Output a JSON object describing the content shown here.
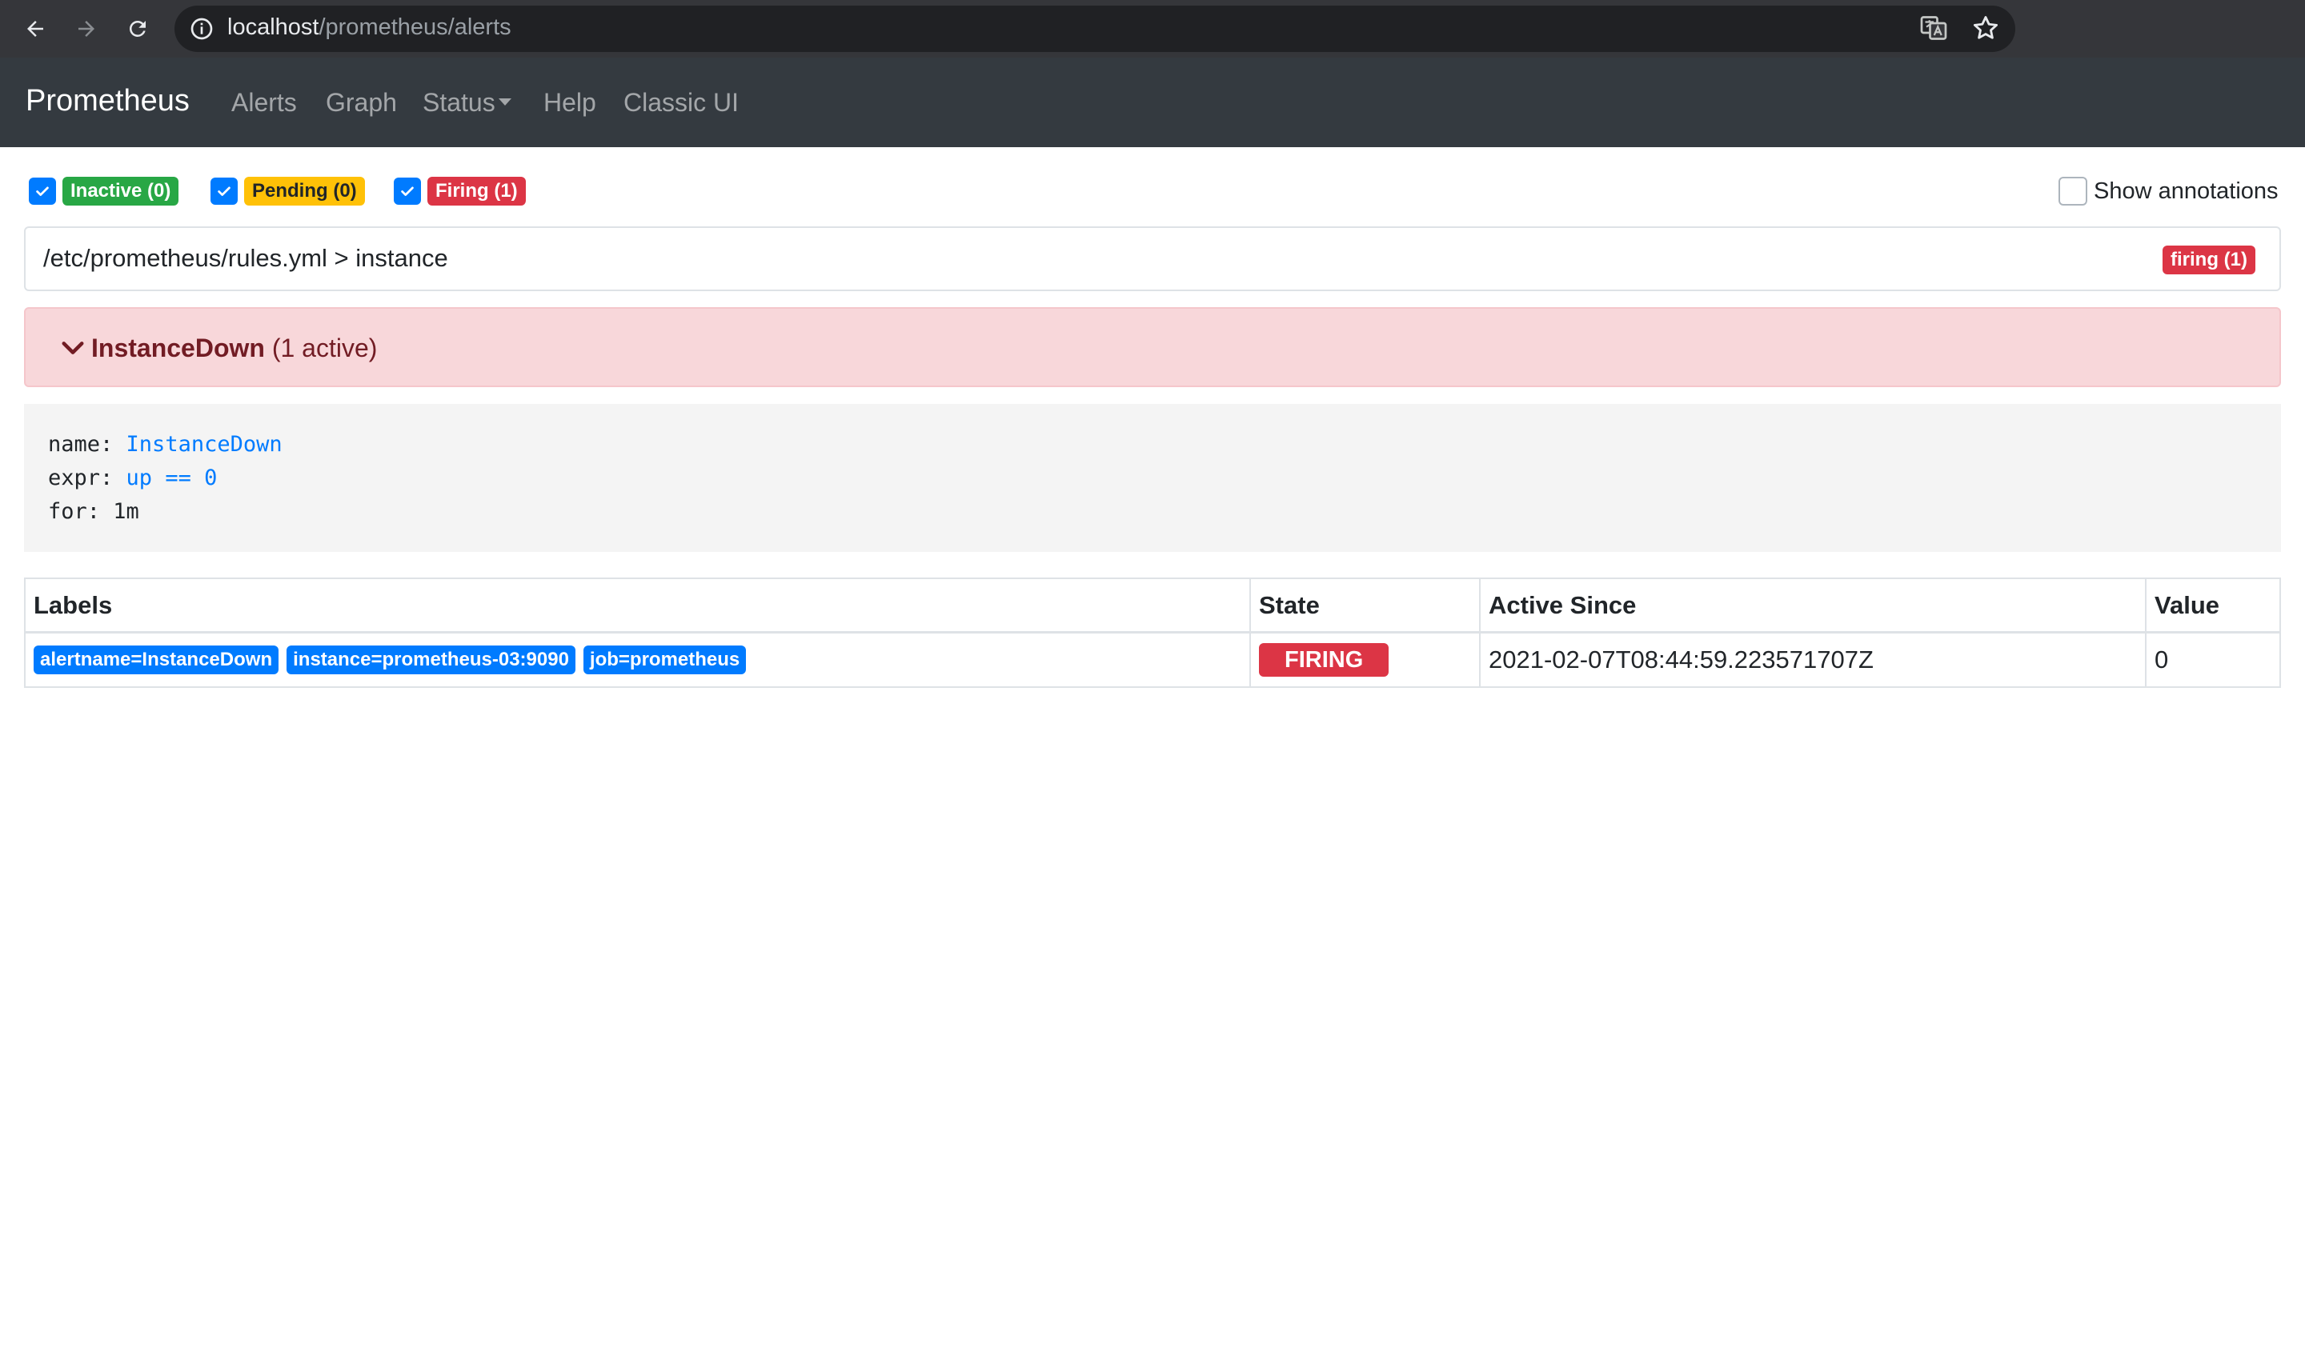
{
  "browser": {
    "url_host": "localhost",
    "url_path": "/prometheus/alerts"
  },
  "navbar": {
    "brand": "Prometheus",
    "links": [
      "Alerts",
      "Graph",
      "Status",
      "Help",
      "Classic UI"
    ]
  },
  "filters": {
    "inactive": "Inactive (0)",
    "pending": "Pending (0)",
    "firing": "Firing (1)",
    "show_annotations": "Show annotations"
  },
  "group": {
    "title": "/etc/prometheus/rules.yml > instance",
    "badge": "firing (1)"
  },
  "alert": {
    "name": "InstanceDown",
    "active": "(1 active)"
  },
  "rule": {
    "name_key": "name: ",
    "name_val": "InstanceDown",
    "expr_key": "expr: ",
    "expr_val": "up == 0",
    "for_key": "for: ",
    "for_val": "1m"
  },
  "table": {
    "headers": [
      "Labels",
      "State",
      "Active Since",
      "Value"
    ],
    "row": {
      "labels": [
        "alertname=InstanceDown",
        "instance=prometheus-03:9090",
        "job=prometheus"
      ],
      "state": "FIRING",
      "active_since": "2021-02-07T08:44:59.223571707Z",
      "value": "0"
    }
  },
  "colors": {
    "firing": "#dc3545",
    "inactive": "#28a745",
    "pending": "#ffc107",
    "primary": "#007bff",
    "navbar": "#343a40"
  },
  "icons": [
    "back-icon",
    "forward-icon",
    "reload-icon",
    "info-icon",
    "translate-icon",
    "star-icon",
    "check-icon",
    "chevron-down-icon"
  ]
}
